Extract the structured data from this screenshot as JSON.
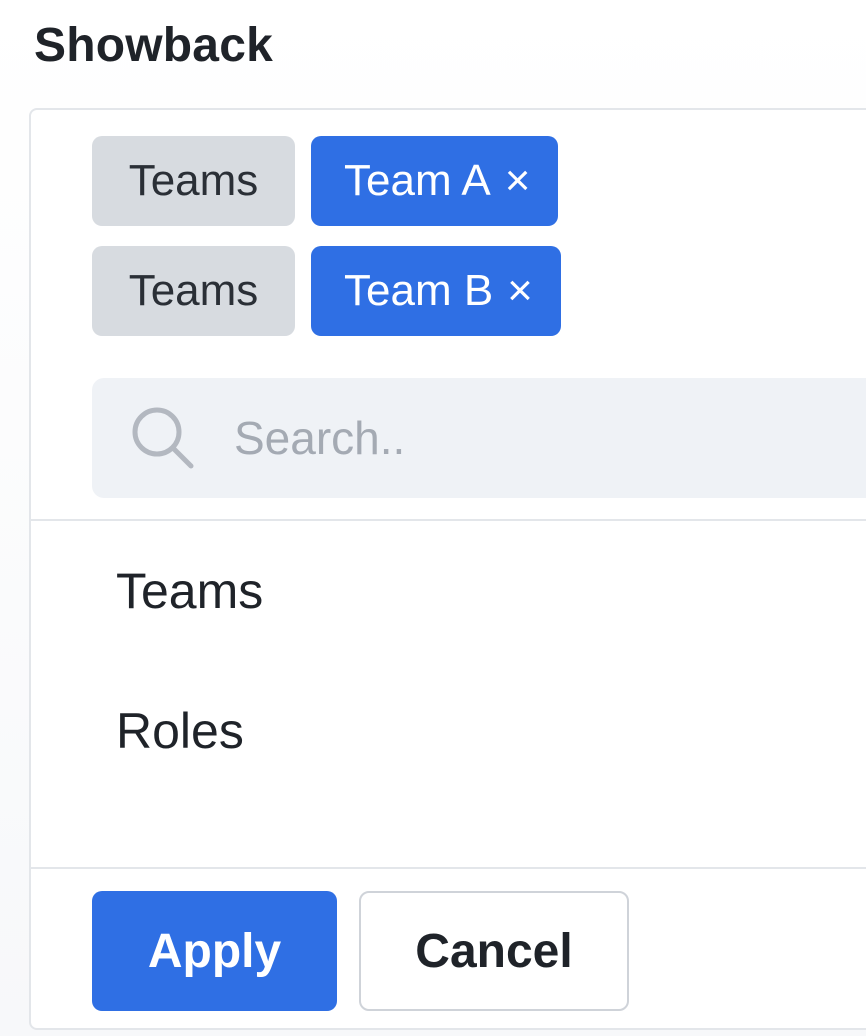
{
  "page": {
    "title": "Showback"
  },
  "filters": [
    {
      "category": "Teams",
      "value": "Team A",
      "remove_glyph": "×"
    },
    {
      "category": "Teams",
      "value": "Team B",
      "remove_glyph": "×"
    }
  ],
  "search": {
    "placeholder": "Search..",
    "value": "",
    "icon": "search-icon"
  },
  "options": [
    {
      "label": "Teams"
    },
    {
      "label": "Roles"
    }
  ],
  "footer": {
    "apply_label": "Apply",
    "cancel_label": "Cancel"
  },
  "colors": {
    "accent": "#2f6fe4",
    "chip_category_bg": "#d7dbe0",
    "search_bg": "#eff2f6",
    "border": "#e3e6ea"
  }
}
